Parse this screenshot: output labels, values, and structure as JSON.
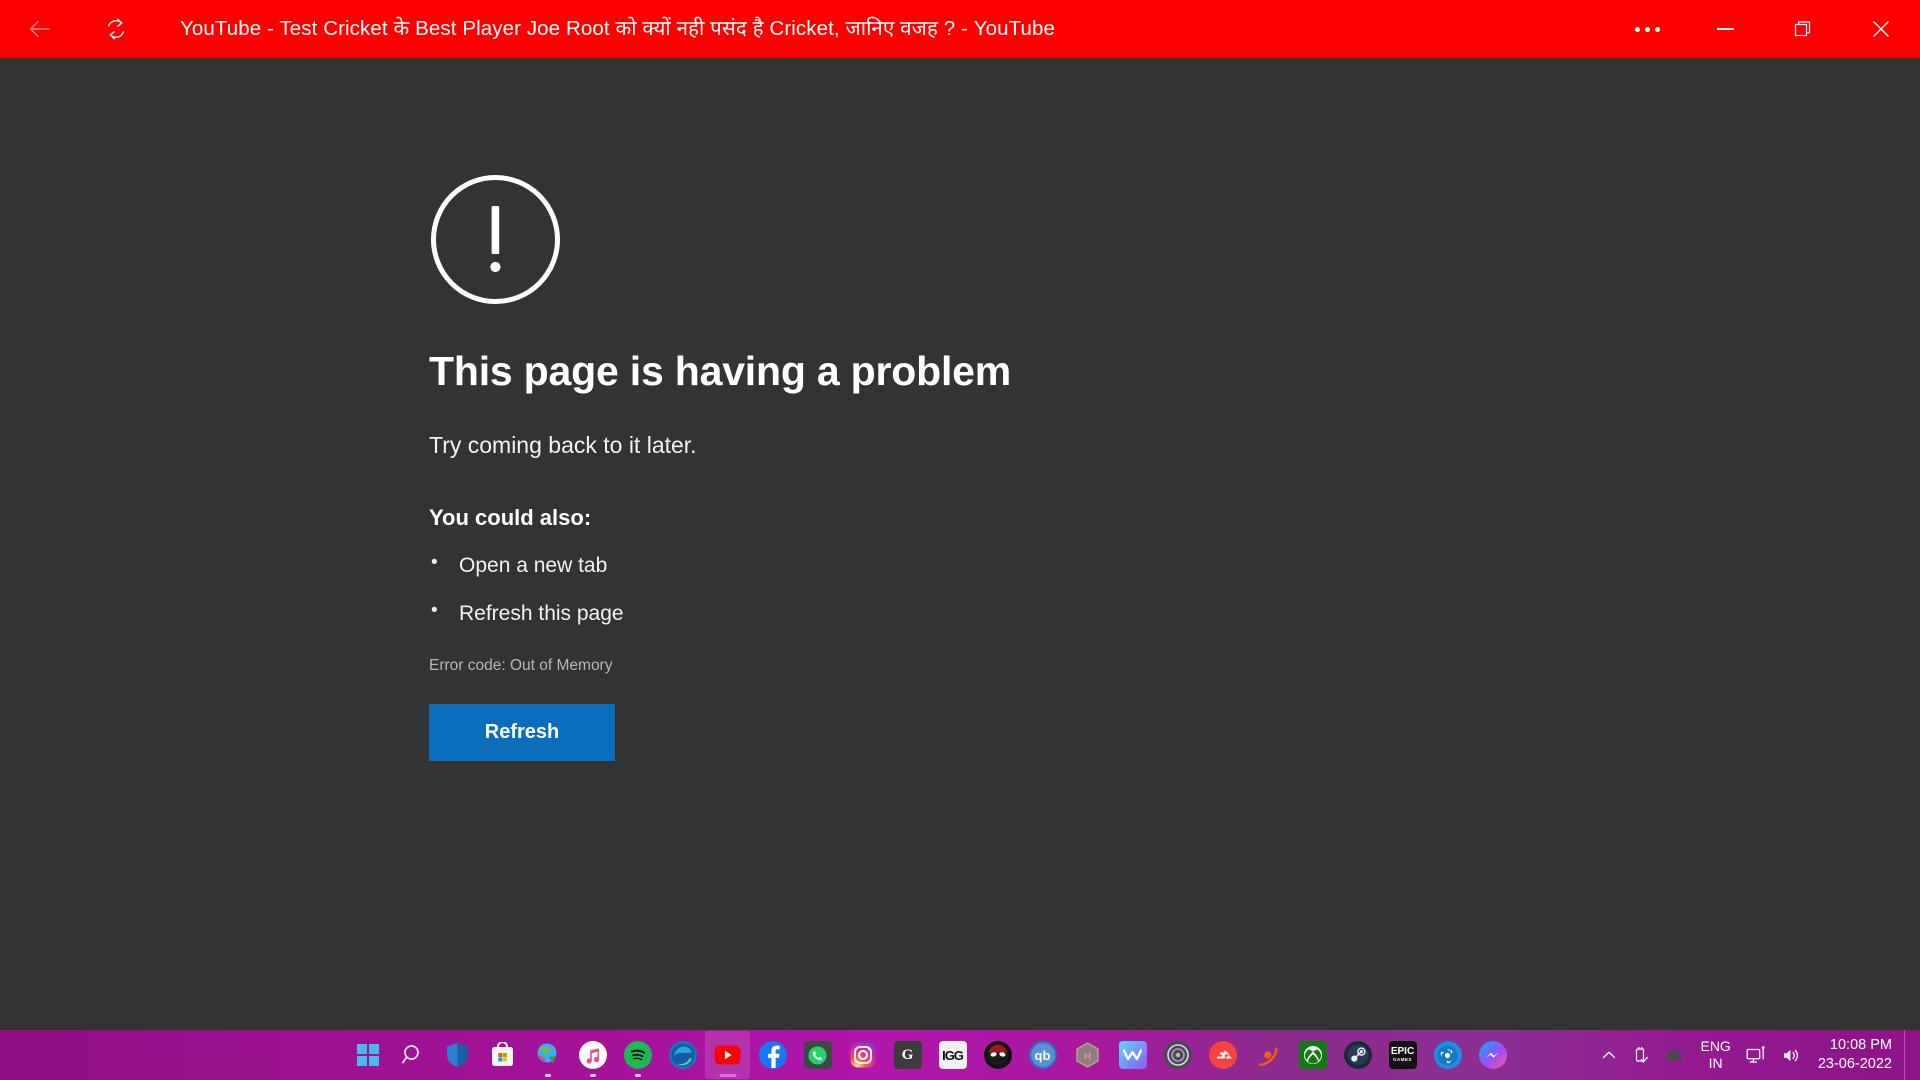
{
  "window": {
    "title": "YouTube - Test Cricket के Best Player Joe Root को क्यों नही पसंद है Cricket, जानिए वजह ? - YouTube",
    "back_tooltip": "Back",
    "refresh_tooltip": "Refresh",
    "more_tooltip": "See more",
    "minimize_tooltip": "Minimize",
    "maximize_tooltip": "Restore",
    "close_tooltip": "Close",
    "titlebar_color": "#FF0000",
    "content_color": "#333333"
  },
  "error_page": {
    "icon": "exclamation-circle-icon",
    "heading": "This page is having a problem",
    "subtext": "Try coming back to it later.",
    "suggestions_heading": "You could also:",
    "suggestions": [
      "Open a new tab",
      "Refresh this page"
    ],
    "error_code": "Error code: Out of Memory",
    "refresh_button": "Refresh",
    "accent_color": "#0a6ebd"
  },
  "taskbar": {
    "background_color": "#a5129a",
    "items": [
      {
        "name": "start-button",
        "icon": "windows-logo-icon",
        "label": "Start",
        "running": false
      },
      {
        "name": "search-button",
        "icon": "search-icon",
        "label": "Search",
        "running": false
      },
      {
        "name": "windows-security",
        "icon": "shield-icon",
        "label": "Windows Security",
        "running": false
      },
      {
        "name": "microsoft-store",
        "icon": "store-bag-icon",
        "label": "Microsoft Store",
        "running": false
      },
      {
        "name": "internet-download-manager",
        "icon": "globe-down-icon",
        "label": "Internet Download Manager",
        "running": false
      },
      {
        "name": "itunes",
        "icon": "music-note-icon",
        "label": "iTunes",
        "running": true
      },
      {
        "name": "spotify",
        "icon": "spotify-icon",
        "label": "Spotify",
        "running": true
      },
      {
        "name": "microsoft-edge",
        "icon": "edge-icon",
        "label": "Microsoft Edge",
        "running": false
      },
      {
        "name": "youtube",
        "icon": "youtube-icon",
        "label": "YouTube",
        "running": true,
        "active": true
      },
      {
        "name": "facebook",
        "icon": "facebook-icon",
        "label": "Facebook",
        "running": false
      },
      {
        "name": "whatsapp",
        "icon": "whatsapp-icon",
        "label": "WhatsApp",
        "running": false
      },
      {
        "name": "instagram",
        "icon": "instagram-icon",
        "label": "Instagram",
        "running": false
      },
      {
        "name": "google",
        "icon": "google-g-icon",
        "label": "Google",
        "running": false
      },
      {
        "name": "igg-games",
        "icon": "igg-icon",
        "label": "IGG",
        "running": false
      },
      {
        "name": "deadpool-app",
        "icon": "deadpool-mask-icon",
        "label": "Deadpool",
        "running": false
      },
      {
        "name": "qbittorrent",
        "icon": "qbittorrent-icon",
        "label": "qBittorrent",
        "running": false
      },
      {
        "name": "hexagon-app",
        "icon": "hexagon-h-icon",
        "label": "Hex App",
        "running": false
      },
      {
        "name": "w-app",
        "icon": "w-wing-icon",
        "label": "W App",
        "running": false
      },
      {
        "name": "ubisoft-connect",
        "icon": "ubisoft-icon",
        "label": "Ubisoft Connect",
        "running": false
      },
      {
        "name": "ea-app",
        "icon": "ea-icon",
        "label": "EA",
        "running": false
      },
      {
        "name": "origin",
        "icon": "origin-icon",
        "label": "Origin",
        "running": false
      },
      {
        "name": "xbox",
        "icon": "xbox-icon",
        "label": "Xbox",
        "running": false
      },
      {
        "name": "steam",
        "icon": "steam-icon",
        "label": "Steam",
        "running": false
      },
      {
        "name": "epic-games",
        "icon": "epic-games-icon",
        "label": "Epic Games",
        "running": false
      },
      {
        "name": "battle-net",
        "icon": "battlenet-icon",
        "label": "Battle.net",
        "running": false
      },
      {
        "name": "messenger",
        "icon": "messenger-icon",
        "label": "Messenger",
        "running": false
      }
    ],
    "tray": {
      "overflow_label": "Show hidden icons",
      "usb_label": "Safely Remove Hardware and Eject Media",
      "onedrive_label": "OneDrive",
      "language_line1": "ENG",
      "language_line2": "IN",
      "network_label": "Network",
      "volume_label": "Volume",
      "time": "10:08 PM",
      "date": "23-06-2022"
    }
  }
}
